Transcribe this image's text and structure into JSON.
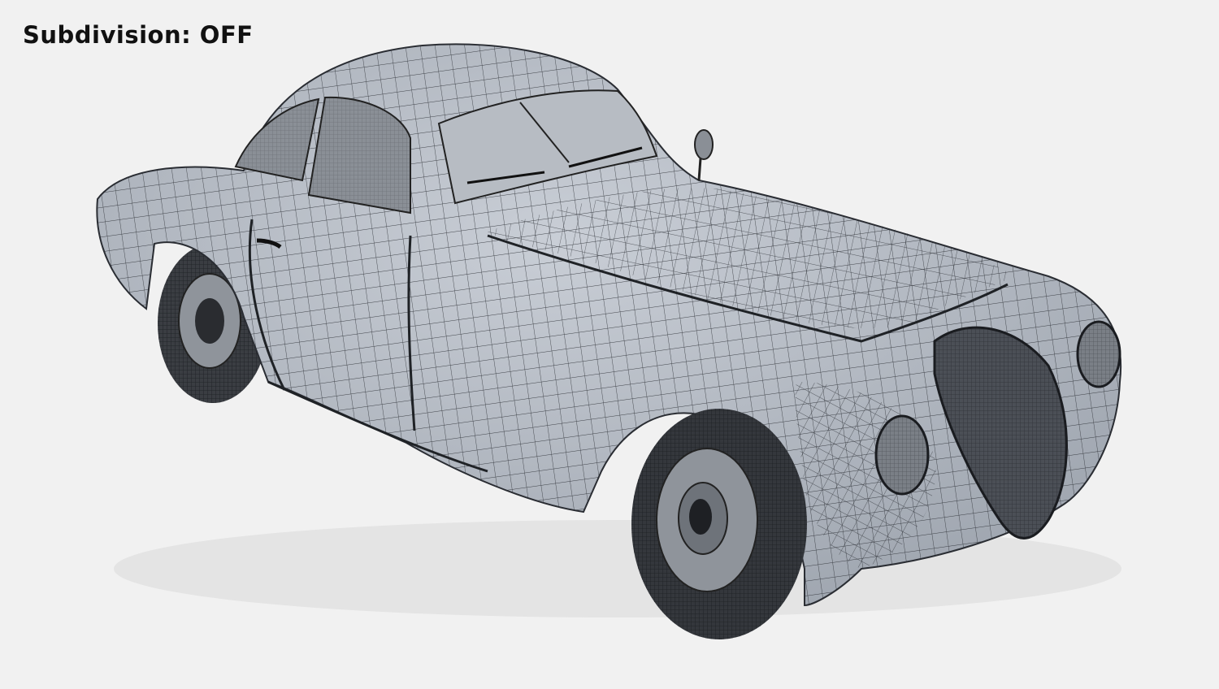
{
  "caption": "Subdivision: OFF"
}
